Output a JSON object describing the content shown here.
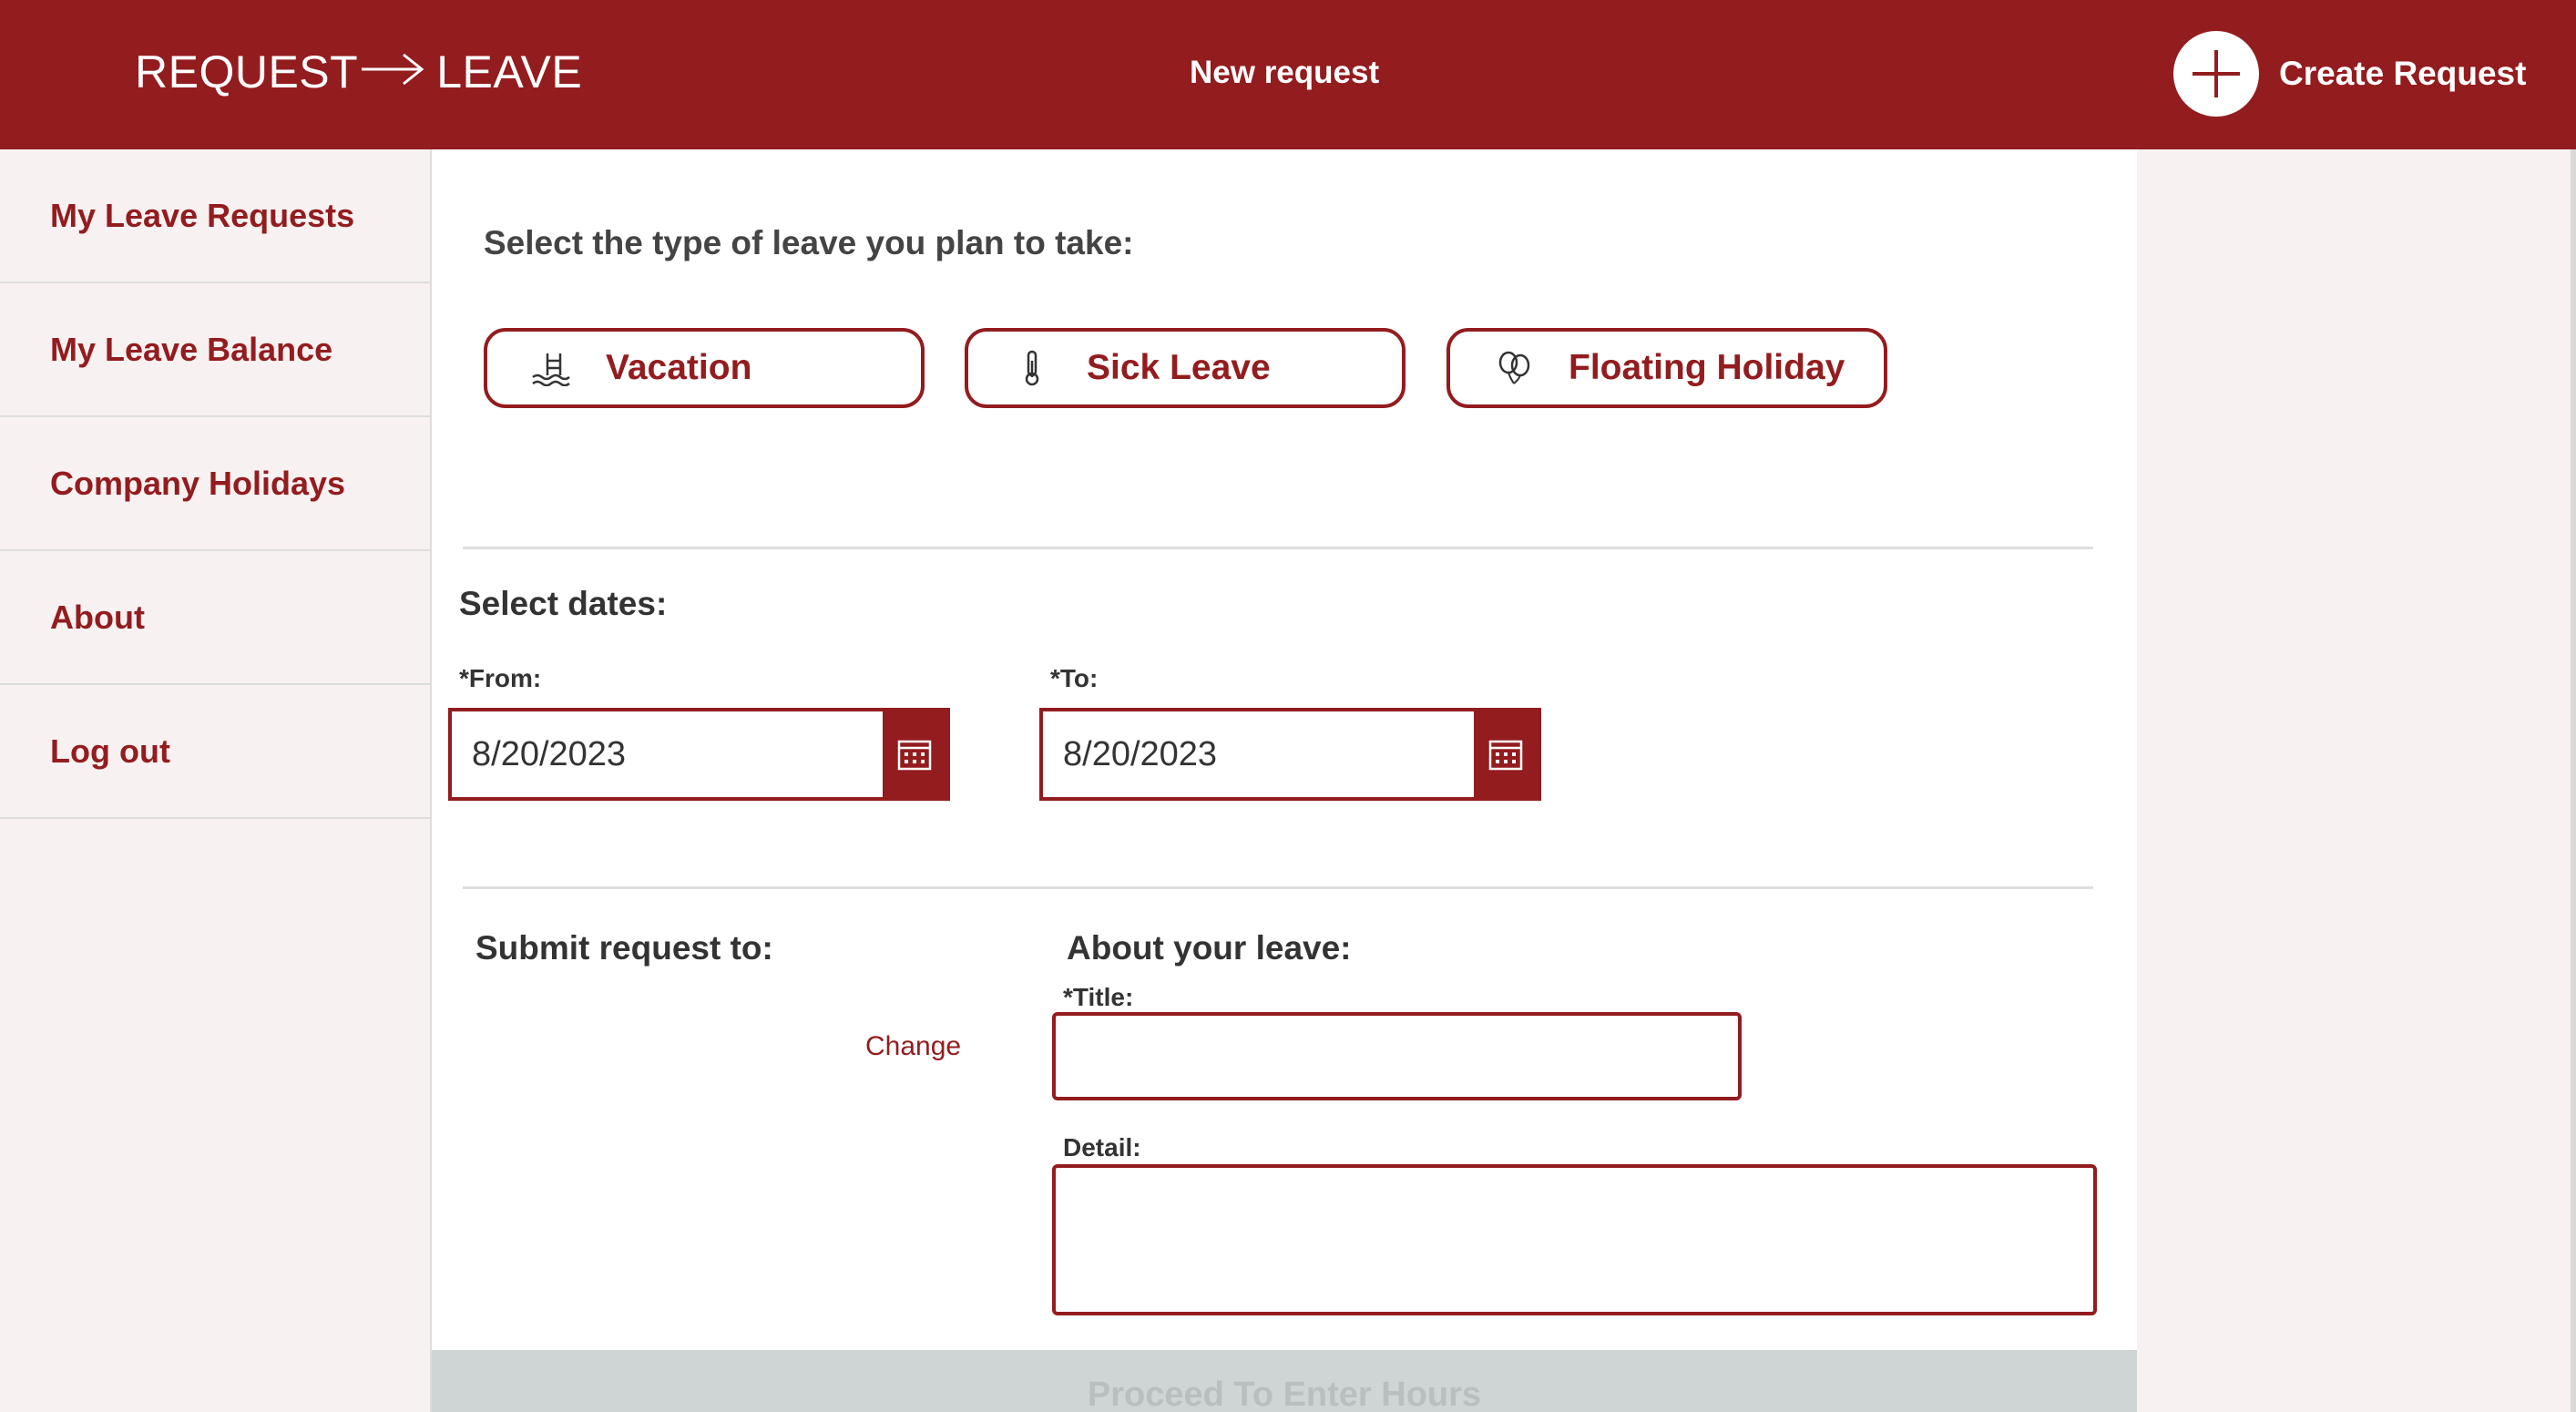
{
  "header": {
    "logo_left": "REQUEST",
    "logo_right": "LEAVE",
    "title": "New request",
    "create_label": "Create Request"
  },
  "sidebar": {
    "items": [
      {
        "label": "My Leave Requests"
      },
      {
        "label": "My Leave Balance"
      },
      {
        "label": "Company Holidays"
      },
      {
        "label": "About"
      },
      {
        "label": "Log out"
      }
    ]
  },
  "leave_types": {
    "prompt": "Select the type of leave you plan to take:",
    "options": [
      {
        "label": "Vacation",
        "icon": "pool-ladder-icon"
      },
      {
        "label": "Sick Leave",
        "icon": "thermometer-icon"
      },
      {
        "label": "Floating Holiday",
        "icon": "balloons-icon"
      }
    ]
  },
  "dates": {
    "title": "Select dates:",
    "from_label": "*From:",
    "from_value": "8/20/2023",
    "to_label": "*To:",
    "to_value": "8/20/2023"
  },
  "submit": {
    "title": "Submit request to:",
    "change_label": "Change"
  },
  "about": {
    "title": "About your leave:",
    "title_label": "*Title:",
    "title_value": "",
    "detail_label": "Detail:",
    "detail_value": ""
  },
  "footer": {
    "proceed_label": "Proceed To Enter Hours"
  },
  "colors": {
    "brand": "#931c1f",
    "background": "#f8f1f1",
    "disabled": "#cfd4d4"
  }
}
